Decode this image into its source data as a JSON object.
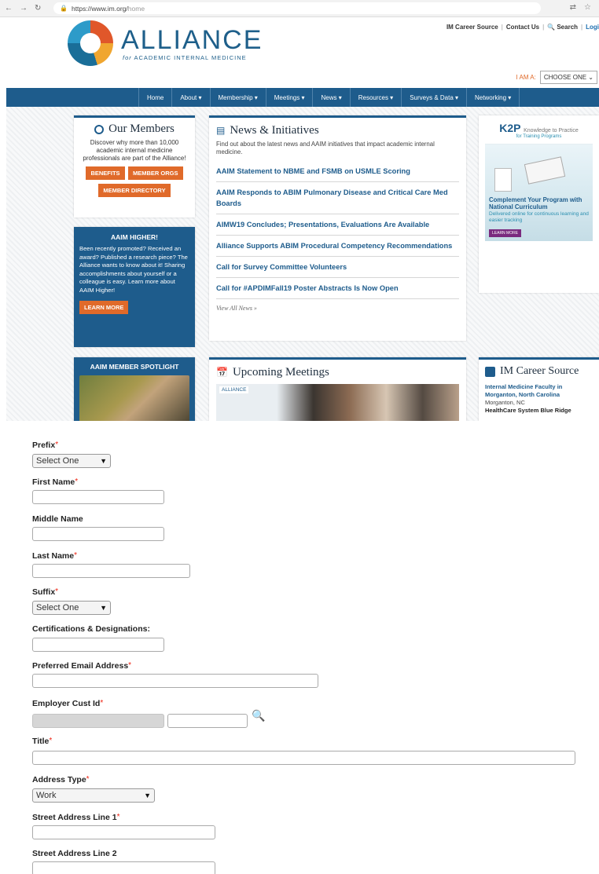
{
  "browser": {
    "url_base": "https://www.im.org/",
    "url_path": "home"
  },
  "header": {
    "logo_big": "ALLIANCE",
    "logo_for": "for",
    "logo_small": "ACADEMIC INTERNAL MEDICINE",
    "links": [
      "IM Career Source",
      "Contact Us",
      "Search",
      "Logi"
    ],
    "i_am_a_label": "I AM A:",
    "i_am_a_value": "CHOOSE ONE"
  },
  "nav": [
    "Home",
    "About ▾",
    "Membership ▾",
    "Meetings ▾",
    "News ▾",
    "Resources ▾",
    "Surveys & Data ▾",
    "Networking ▾"
  ],
  "members": {
    "title": "Our Members",
    "text": "Discover why more than 10,000 academic internal medicine professionals are part of the Alliance!",
    "btn_benefits": "BENEFITS",
    "btn_orgs": "MEMBER ORGS",
    "btn_directory": "MEMBER DIRECTORY"
  },
  "higher": {
    "title": "AAIM HIGHER!",
    "text": "Been recently promoted? Received an award? Published a research piece? The Alliance wants to know about it! Sharing accomplishments about yourself or a colleague is easy. Learn more about AAIM Higher!",
    "btn": "LEARN MORE"
  },
  "spotlight": {
    "title": "AAIM MEMBER SPOTLIGHT"
  },
  "news": {
    "title": "News & Initiatives",
    "intro": "Find out about the latest news and AAIM initiatives that impact academic internal medicine.",
    "items": [
      "AAIM Statement to NBME and FSMB on USMLE Scoring",
      "AAIM Responds to ABIM Pulmonary Disease and Critical Care Med Boards",
      "AIMW19 Concludes; Presentations, Evaluations Are Available",
      "Alliance Supports ABIM Procedural Competency Recommendations",
      "Call for Survey Committee Volunteers",
      "Call for #APDIMFall19 Poster Abstracts Is Now Open"
    ],
    "view_all": "View All News »"
  },
  "meetings": {
    "title": "Upcoming Meetings",
    "banner_label": "ALLIANCE"
  },
  "ad": {
    "brand": "K2P",
    "brand_sub": "Knowledge to Practice",
    "tag": "for Training Programs",
    "headline": "Complement Your Program with National Curriculum",
    "desc": "Delivered online for continuous learning and easier tracking",
    "btn": "LEARN MORE"
  },
  "career": {
    "title": "IM Career Source",
    "job": "Internal Medicine Faculty in Morganton, North Carolina",
    "location": "Morganton, NC",
    "employer": "HealthCare System Blue Ridge"
  },
  "form": {
    "prefix": {
      "label": "Prefix",
      "value": "Select One"
    },
    "first_name": {
      "label": "First Name",
      "value": ""
    },
    "middle_name": {
      "label": "Middle Name",
      "value": ""
    },
    "last_name": {
      "label": "Last Name",
      "value": ""
    },
    "suffix": {
      "label": "Suffix",
      "value": "Select One"
    },
    "certifications": {
      "label": "Certifications & Designations:",
      "value": ""
    },
    "email": {
      "label": "Preferred Email Address",
      "value": ""
    },
    "employer": {
      "label": "Employer Cust Id",
      "value": ""
    },
    "title": {
      "label": "Title",
      "value": ""
    },
    "address_type": {
      "label": "Address Type",
      "value": "Work"
    },
    "street1": {
      "label": "Street Address Line 1",
      "value": ""
    },
    "street2": {
      "label": "Street Address Line 2",
      "value": ""
    },
    "required_mark": "*"
  }
}
